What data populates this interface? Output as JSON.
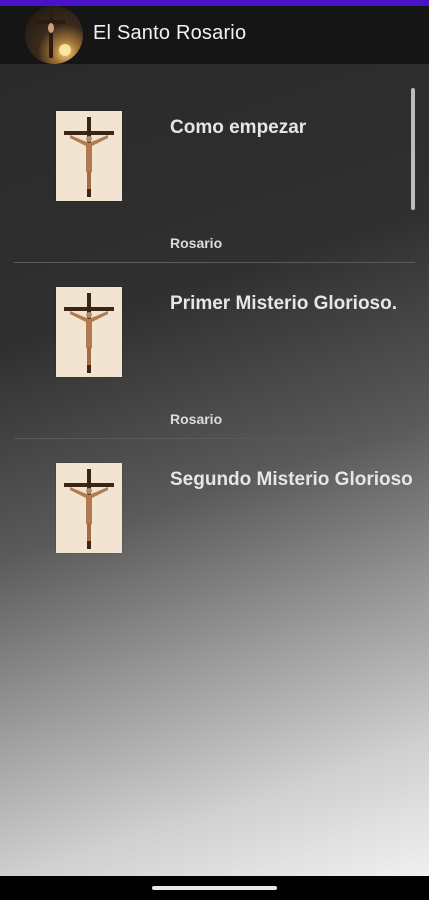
{
  "app": {
    "title": "El Santo Rosario"
  },
  "items": [
    {
      "title": "Como empezar",
      "subtitle": "Rosario"
    },
    {
      "title": "Primer Misterio Glorioso.",
      "subtitle": "Rosario"
    },
    {
      "title": "Segundo Misterio Glorioso",
      "subtitle": ""
    }
  ],
  "colors": {
    "status_bar": "#4a12c8",
    "app_bar": "#151515"
  }
}
